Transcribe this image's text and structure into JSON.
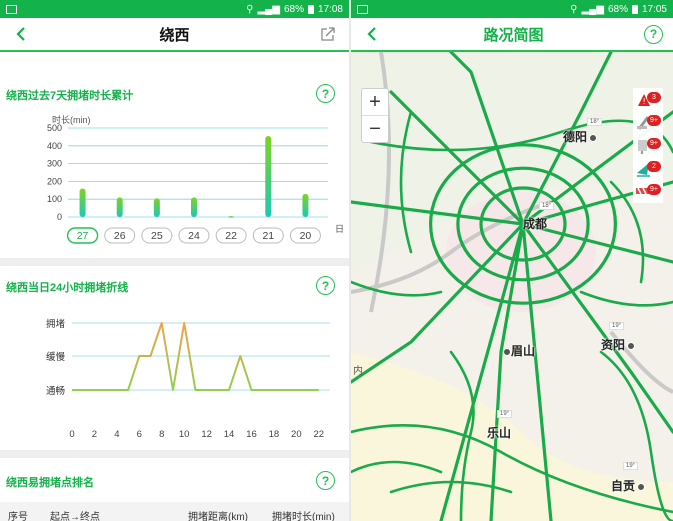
{
  "left": {
    "status": {
      "time": "17:08",
      "battery": "68%"
    },
    "nav": {
      "title": "绕西"
    },
    "weekly": {
      "title": "绕西过去7天拥堵时长累计",
      "y_unit": "时长(min)",
      "x_unit": "日",
      "y_ticks": [
        "500",
        "400",
        "300",
        "200",
        "100",
        "0"
      ],
      "days": [
        "27",
        "26",
        "25",
        "24",
        "22",
        "21",
        "20"
      ],
      "selected_day": "27"
    },
    "daily": {
      "title": "绕西当日24小时拥堵折线",
      "levels": [
        "拥堵",
        "缓慢",
        "通畅"
      ],
      "x_ticks": [
        "0",
        "2",
        "4",
        "6",
        "8",
        "10",
        "12",
        "14",
        "16",
        "18",
        "20",
        "22"
      ]
    },
    "ranking": {
      "title": "绕西易拥堵点排名",
      "headers": [
        "序号",
        "起点→终点",
        "拥堵距离(km)",
        "拥堵时长(min)"
      ]
    }
  },
  "right": {
    "status": {
      "time": "17:05",
      "battery": "68%"
    },
    "nav": {
      "title": "路况简图"
    },
    "zoom": {
      "in": "+",
      "out": "−"
    },
    "legend": [
      {
        "name": "accident",
        "badge": "3"
      },
      {
        "name": "construction",
        "badge": "9+"
      },
      {
        "name": "control",
        "badge": "9+"
      },
      {
        "name": "weather",
        "badge": "2"
      },
      {
        "name": "closure",
        "badge": "9+"
      }
    ],
    "cities": [
      "德阳",
      "成都",
      "眉山",
      "资阳",
      "乐山",
      "自贡"
    ],
    "weather_temps": [
      "18°",
      "18°",
      "19°",
      "19°",
      "19°"
    ],
    "side_text": "内"
  },
  "chart_data": [
    {
      "type": "bar",
      "title": "绕西过去7天拥堵时长累计",
      "ylabel": "时长(min)",
      "xlabel": "日",
      "categories": [
        "27",
        "26",
        "25",
        "24",
        "22",
        "21",
        "20"
      ],
      "values": [
        160,
        110,
        105,
        110,
        5,
        455,
        130
      ],
      "ylim": [
        0,
        500
      ],
      "colors": {
        "top": "#7ed321",
        "bottom": "#1ec8b8",
        "grid": "#7fd6e0"
      }
    },
    {
      "type": "line",
      "title": "绕西当日24小时拥堵折线",
      "x": [
        0,
        5,
        6,
        7,
        8,
        9,
        10,
        11,
        14,
        15,
        16,
        22
      ],
      "y": [
        0,
        0,
        1,
        1,
        2,
        0,
        2,
        0,
        0,
        1,
        0,
        0
      ],
      "y_categories": [
        "通畅",
        "缓慢",
        "拥堵"
      ],
      "xlim": [
        0,
        23
      ],
      "colors": {
        "low": "#8fd14f",
        "high": "#f2a24a"
      }
    }
  ]
}
